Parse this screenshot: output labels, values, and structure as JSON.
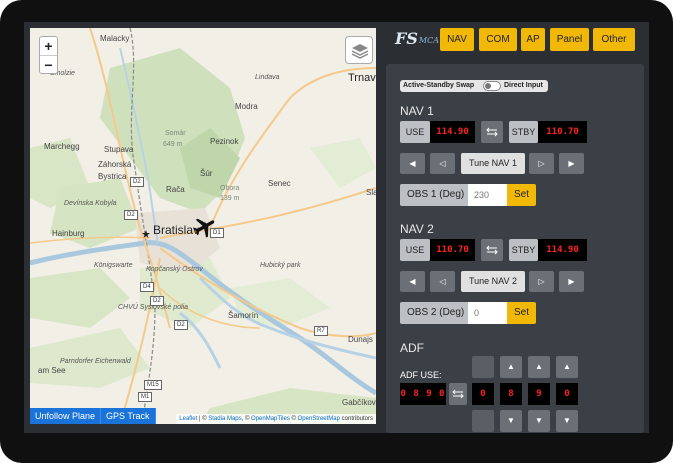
{
  "map": {
    "zoom_in": "+",
    "zoom_out": "−",
    "places": {
      "malacky": "Malacky",
      "trnava": "Trnav",
      "smolzie": "Smolzie",
      "lindava": "Lindava",
      "modra": "Modra",
      "somar": "Somár",
      "somar_elev": "649 m",
      "pezinok": "Pezinok",
      "marchegg": "Marchegg",
      "stupava": "Stupava",
      "zahorska": "Záhorská",
      "bystrica": "Bystrica",
      "sur": "Šúr",
      "raca": "Rača",
      "obora": "Obora",
      "obora_elev": "139 m",
      "senec": "Senec",
      "sla": "Sla",
      "devinska": "Devínska Kobyla",
      "hainburg": "Hainburg",
      "bratislava": "Bratislav",
      "konigswarte": "Königswarte",
      "kopcansky": "Kopčanský Ostrov",
      "hubicky": "Hubický park",
      "chvu": "CHVÚ Syslovské polia",
      "samorin": "Šamorín",
      "dunajs": "Dunajs",
      "eichenwald": "Parndorfer Eichenwald",
      "seewinkel": "am See",
      "gabcikovo": "Gabčíkov"
    },
    "shields": [
      "D2",
      "D2",
      "D1",
      "D4",
      "D2",
      "D2",
      "R7",
      "M15",
      "M1"
    ],
    "buttons": {
      "unfollow": "Unfollow Plane",
      "gps": "GPS Track"
    },
    "attribution": {
      "leaflet": "Leaflet",
      "stadia": "Stadia Maps",
      "openmaptiles": "OpenMapTiles",
      "osm": "OpenStreetMap",
      "contributors": "contributors"
    }
  },
  "header": {
    "logo": "FS",
    "logo_sub": "MCA",
    "tabs": [
      "NAV",
      "COM",
      "AP",
      "Panel",
      "Other"
    ]
  },
  "swap": {
    "active_standby": "Active-Standby Swap",
    "direct_input": "Direct Input"
  },
  "nav1": {
    "title": "NAV 1",
    "use_label": "USE",
    "use_freq": "114.90",
    "stby_label": "STBY",
    "stby_freq": "110.70",
    "tune_label": "Tune NAV 1",
    "obs_label": "OBS 1 (Deg)",
    "obs_placeholder": "230",
    "set_label": "Set"
  },
  "nav2": {
    "title": "NAV 2",
    "use_label": "USE",
    "use_freq": "110.70",
    "stby_label": "STBY",
    "stby_freq": "114.90",
    "tune_label": "Tune NAV 2",
    "obs_label": "OBS 2 (Deg)",
    "obs_placeholder": "0",
    "set_label": "Set"
  },
  "adf": {
    "title": "ADF",
    "use_label": "ADF USE:",
    "use_value": "0 8 9 0",
    "digits": [
      "0",
      "8",
      "9",
      "0"
    ]
  },
  "colors": {
    "accent": "#f2b807",
    "lcd_text": "#ff2222",
    "map_button": "#1a73d8"
  },
  "icons": {
    "swap": "swap-arrows-icon",
    "prev_fast": "triangle-left-icon",
    "prev": "triangle-left-outline-icon",
    "next": "triangle-right-outline-icon",
    "next_fast": "triangle-right-icon",
    "up": "triangle-up-icon",
    "down": "triangle-down-icon",
    "plane": "plane-icon",
    "layers": "layers-icon"
  }
}
